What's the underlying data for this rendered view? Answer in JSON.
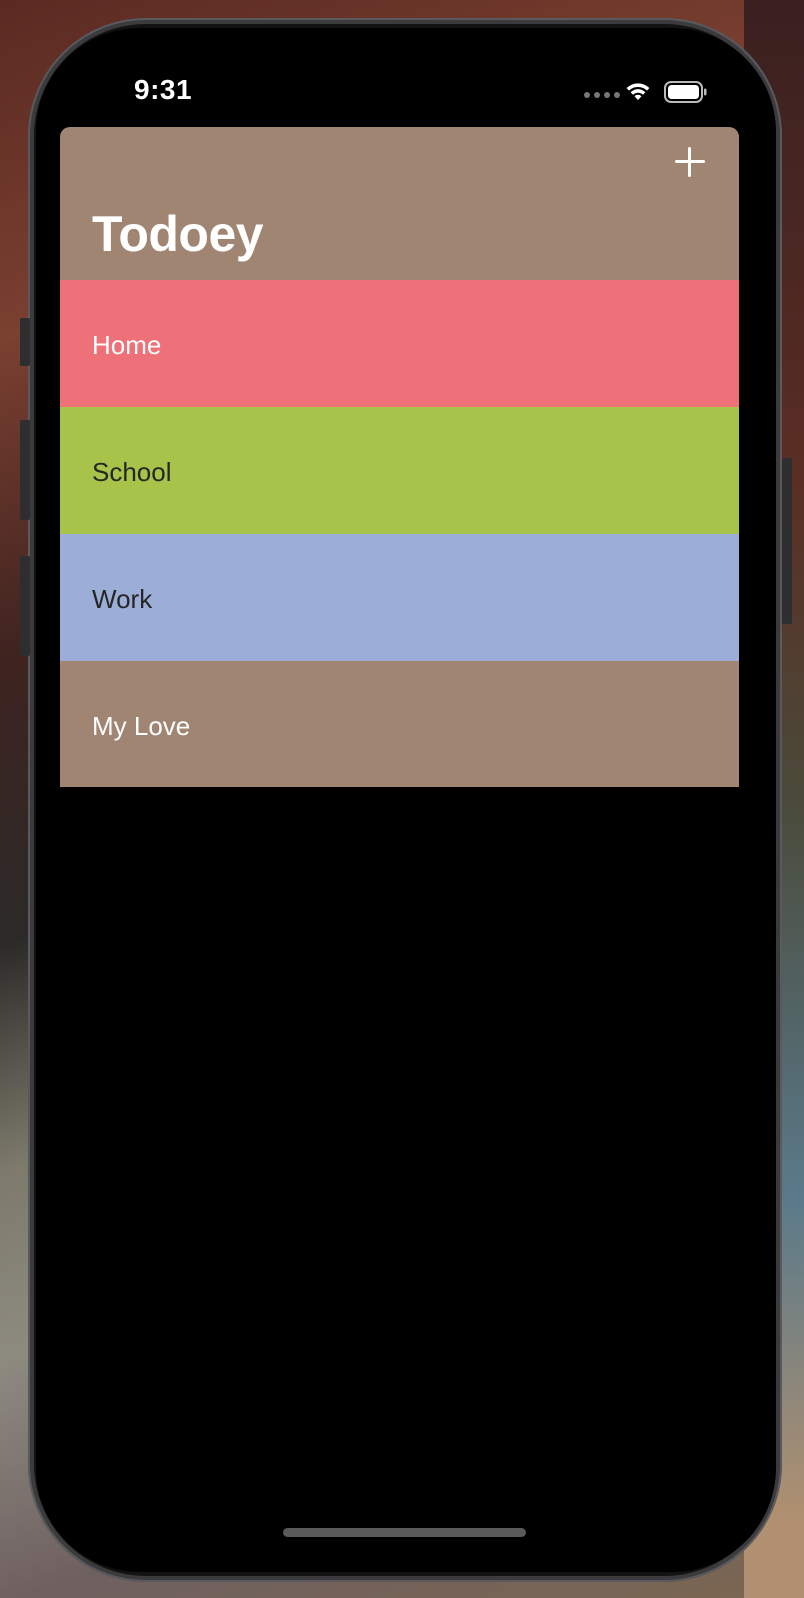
{
  "status_bar": {
    "time": "9:31"
  },
  "nav": {
    "title": "Todoey",
    "add_icon": "plus-icon",
    "background": "#A08572"
  },
  "categories": [
    {
      "label": "Home",
      "background": "#EE7079",
      "text_color": "#FFFFFF"
    },
    {
      "label": "School",
      "background": "#A8C34A",
      "text_color": "#262626"
    },
    {
      "label": "Work",
      "background": "#9CAED7",
      "text_color": "#262626"
    },
    {
      "label": "My Love",
      "background": "#A08572",
      "text_color": "#FFFFFF"
    }
  ]
}
